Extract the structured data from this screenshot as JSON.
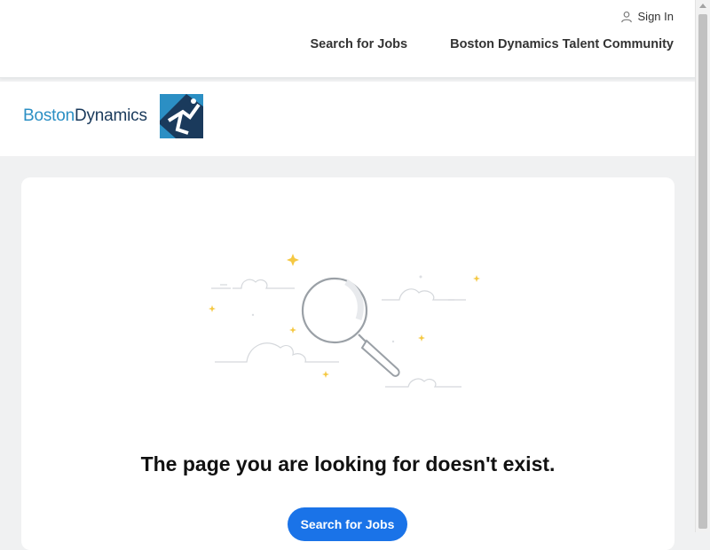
{
  "header": {
    "sign_in_label": "Sign In",
    "nav": [
      {
        "label": "Search for Jobs"
      },
      {
        "label": "Boston Dynamics Talent Community"
      }
    ]
  },
  "brand": {
    "name_part1": "Boston",
    "name_part2": "Dynamics",
    "logo_icon": "boston-dynamics-logo-icon",
    "colors": {
      "light_blue": "#2b8fc4",
      "dark_blue": "#1a3a5c"
    }
  },
  "error": {
    "illustration_icon": "magnifying-glass-icon",
    "message": "The page you are looking for doesn't exist.",
    "button_label": "Search for Jobs"
  },
  "colors": {
    "accent": "#1a73e8",
    "background": "#f0f1f2",
    "sparkle": "#f5c842"
  }
}
